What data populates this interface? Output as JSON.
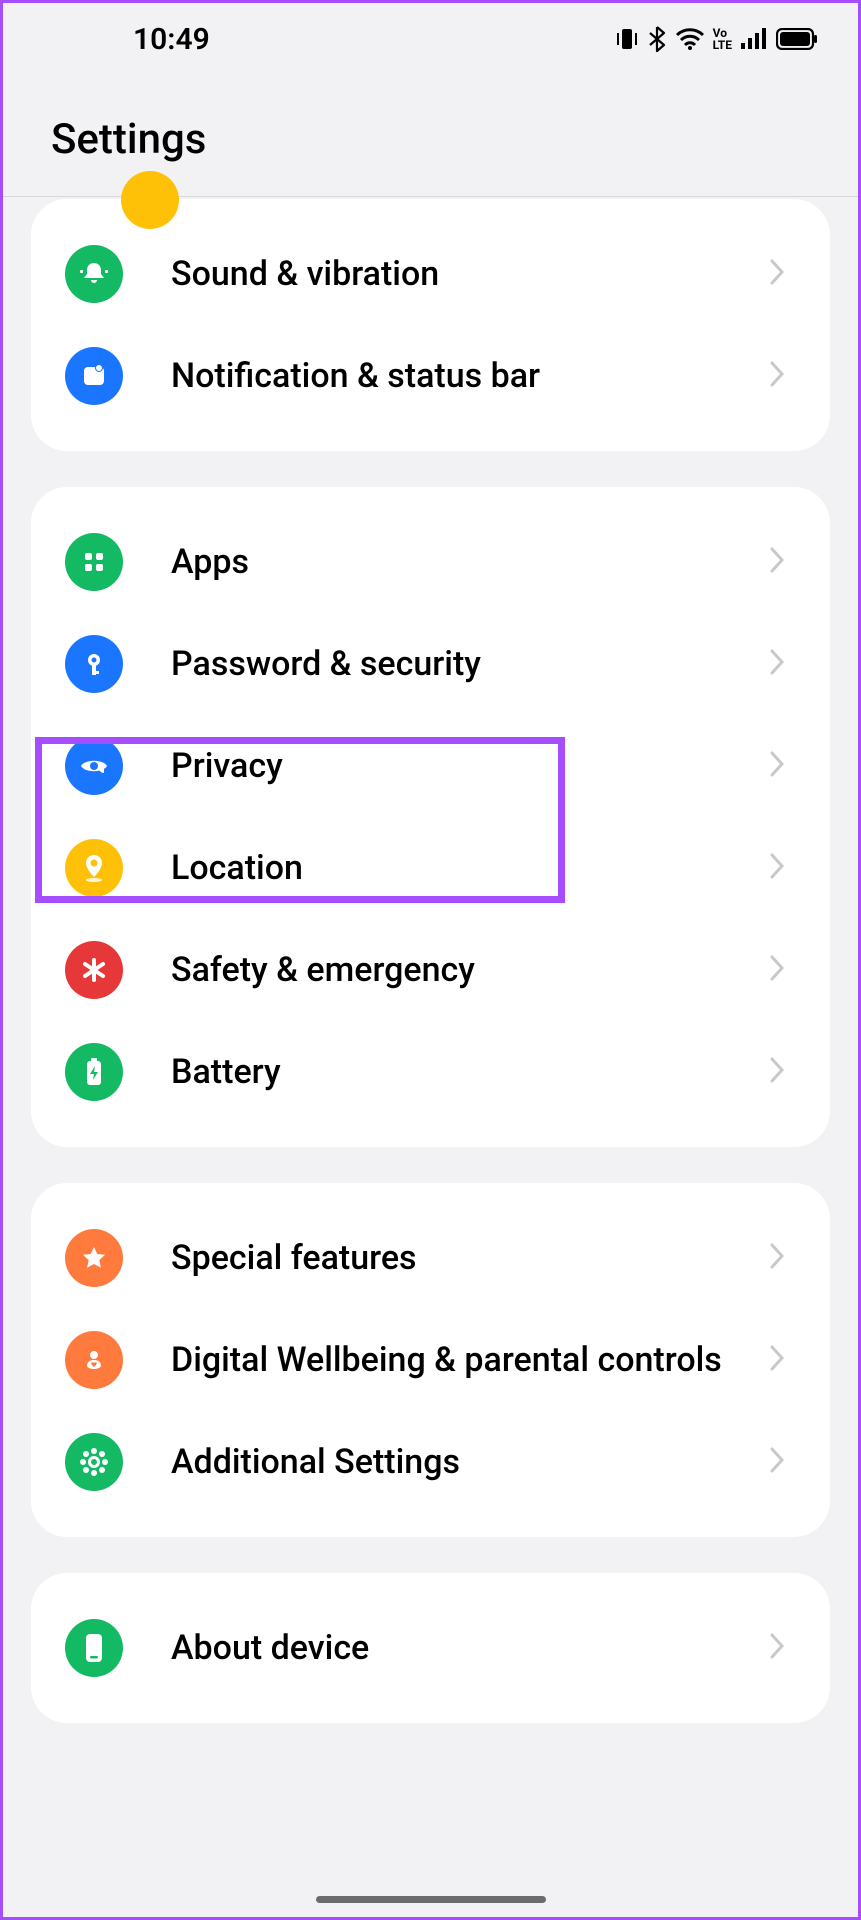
{
  "status": {
    "time": "10:49",
    "icons": [
      "vibrate-icon",
      "bluetooth-icon",
      "wifi-icon",
      "volte-icon",
      "signal-icon",
      "battery-icon"
    ]
  },
  "header": {
    "title": "Settings"
  },
  "groups": [
    {
      "items": [
        {
          "icon": "bell-icon",
          "label": "Sound & vibration",
          "color": "green"
        },
        {
          "icon": "panel-icon",
          "label": "Notification & status bar",
          "color": "blue"
        }
      ]
    },
    {
      "items": [
        {
          "icon": "grid-icon",
          "label": "Apps",
          "color": "green",
          "highlighted": true
        },
        {
          "icon": "key-icon",
          "label": "Password & security",
          "color": "blue"
        },
        {
          "icon": "eye-icon",
          "label": "Privacy",
          "color": "blue"
        },
        {
          "icon": "pin-icon",
          "label": "Location",
          "color": "yellow"
        },
        {
          "icon": "asterisk-icon",
          "label": "Safety & emergency",
          "color": "red"
        },
        {
          "icon": "battery-item-icon",
          "label": "Battery",
          "color": "green"
        }
      ]
    },
    {
      "items": [
        {
          "icon": "star-icon",
          "label": "Special features",
          "color": "orange"
        },
        {
          "icon": "heart-icon",
          "label": "Digital Wellbeing & parental controls",
          "color": "orange"
        },
        {
          "icon": "gear-flower-icon",
          "label": "Additional Settings",
          "color": "green"
        }
      ]
    },
    {
      "items": [
        {
          "icon": "phone-icon",
          "label": "About device",
          "color": "green"
        }
      ]
    }
  ]
}
